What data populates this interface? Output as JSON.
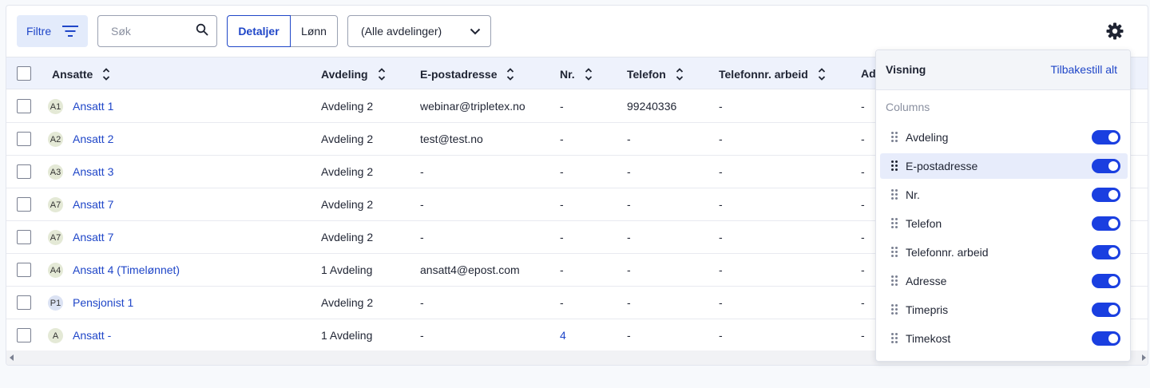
{
  "toolbar": {
    "filter_label": "Filtre",
    "search_placeholder": "Søk",
    "view_toggle": [
      "Detaljer",
      "Lønn"
    ],
    "department_select": "(Alle avdelinger)"
  },
  "table": {
    "columns": [
      "Ansatte",
      "Avdeling",
      "E-postadresse",
      "Nr.",
      "Telefon",
      "Telefonnr. arbeid",
      "Ad"
    ],
    "rows": [
      {
        "initials": "A1",
        "name": "Ansatt 1",
        "avdeling": "Avdeling 2",
        "email": "webinar@tripletex.no",
        "nr": "-",
        "telefon": "99240336",
        "tlf_arbeid": "-",
        "ad": "-"
      },
      {
        "initials": "A2",
        "name": "Ansatt 2",
        "avdeling": "Avdeling 2",
        "email": "test@test.no",
        "nr": "-",
        "telefon": "-",
        "tlf_arbeid": "-",
        "ad": "-"
      },
      {
        "initials": "A3",
        "name": "Ansatt 3",
        "avdeling": "Avdeling 2",
        "email": "-",
        "nr": "-",
        "telefon": "-",
        "tlf_arbeid": "-",
        "ad": "-"
      },
      {
        "initials": "A7",
        "name": "Ansatt 7",
        "avdeling": "Avdeling 2",
        "email": "-",
        "nr": "-",
        "telefon": "-",
        "tlf_arbeid": "-",
        "ad": "-"
      },
      {
        "initials": "A7",
        "name": "Ansatt 7",
        "avdeling": "Avdeling 2",
        "email": "-",
        "nr": "-",
        "telefon": "-",
        "tlf_arbeid": "-",
        "ad": "-"
      },
      {
        "initials": "A4",
        "name": "Ansatt 4 (Timelønnet)",
        "avdeling": "1 Avdeling",
        "email": "ansatt4@epost.com",
        "nr": "-",
        "telefon": "-",
        "tlf_arbeid": "-",
        "ad": "-"
      },
      {
        "initials": "P1",
        "name": "Pensjonist 1",
        "avdeling": "Avdeling 2",
        "email": "-",
        "nr": "-",
        "telefon": "-",
        "tlf_arbeid": "-",
        "ad": "-"
      },
      {
        "initials": "A",
        "name": "Ansatt -",
        "avdeling": "1 Avdeling",
        "email": "-",
        "nr": "4",
        "telefon": "-",
        "tlf_arbeid": "-",
        "ad": "-"
      }
    ]
  },
  "settings": {
    "title": "Visning",
    "reset_label": "Tilbakestill alt",
    "section_label": "Columns",
    "columns": [
      {
        "label": "Avdeling",
        "enabled": true
      },
      {
        "label": "E-postadresse",
        "enabled": true
      },
      {
        "label": "Nr.",
        "enabled": true
      },
      {
        "label": "Telefon",
        "enabled": true
      },
      {
        "label": "Telefonnr. arbeid",
        "enabled": true
      },
      {
        "label": "Adresse",
        "enabled": true
      },
      {
        "label": "Timepris",
        "enabled": true
      },
      {
        "label": "Timekost",
        "enabled": true
      }
    ]
  },
  "colors": {
    "accent": "#1f46c8",
    "toggle_on": "#1a3fe0",
    "header_bg": "#eef2fc"
  }
}
